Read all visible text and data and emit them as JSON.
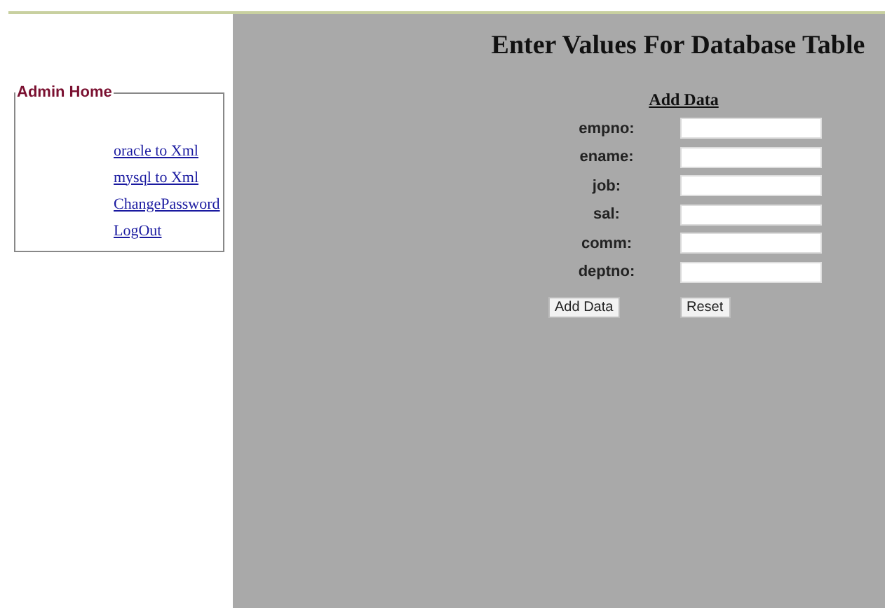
{
  "sidebar": {
    "title": "Admin Home",
    "links": [
      "oracle to Xml",
      "mysql to Xml",
      "ChangePassword",
      "LogOut"
    ]
  },
  "main": {
    "heading": "Enter Values For Database Table",
    "form_title": "Add Data",
    "fields": [
      {
        "label": "empno:"
      },
      {
        "label": "ename:"
      },
      {
        "label": "job:"
      },
      {
        "label": "sal:"
      },
      {
        "label": "comm:"
      },
      {
        "label": "deptno:"
      }
    ],
    "buttons": [
      "Add Data",
      "Reset"
    ]
  }
}
